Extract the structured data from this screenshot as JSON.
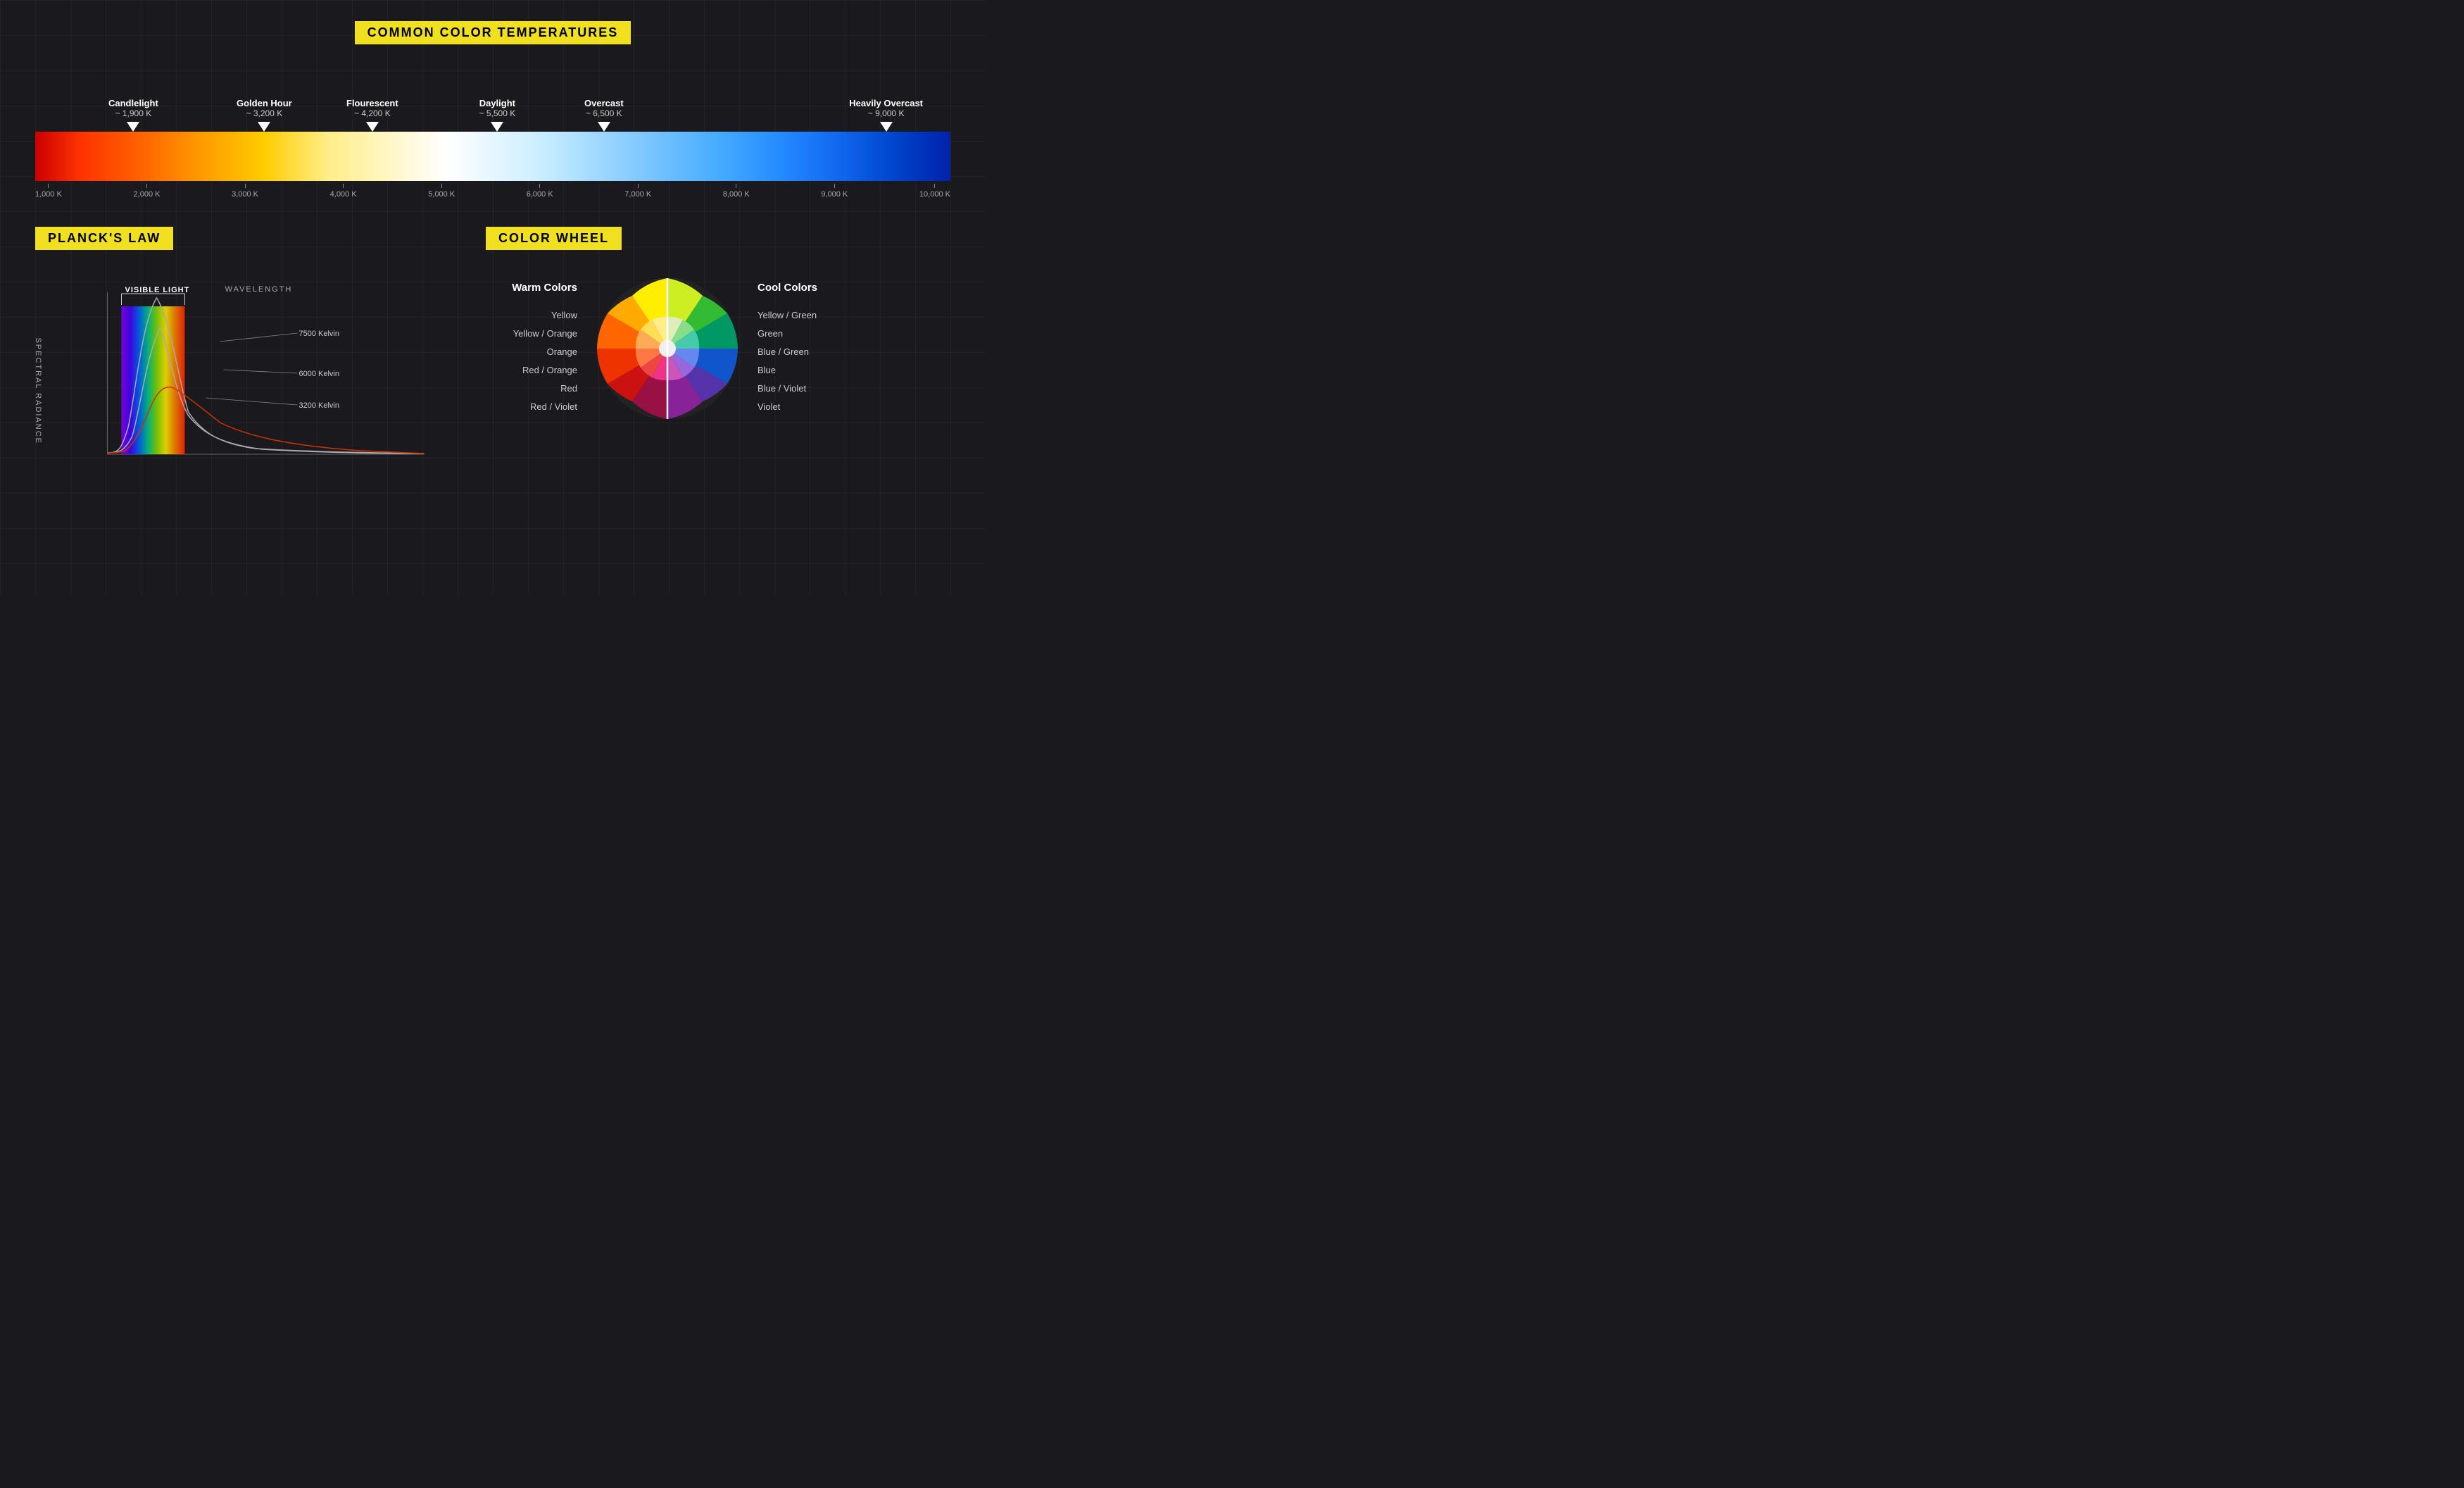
{
  "page": {
    "background": "#1a1a1e"
  },
  "temperature_section": {
    "title": "COMMON COLOR TEMPERATURES",
    "labels": [
      {
        "name": "Candlelight",
        "value": "~ 1,900 K",
        "position": 8
      },
      {
        "name": "Golden Hour",
        "value": "~ 3,200 K",
        "position": 23
      },
      {
        "name": "Flourescent",
        "value": "~ 4,200 K",
        "position": 34
      },
      {
        "name": "Daylight",
        "value": "~ 5,500 K",
        "position": 49
      },
      {
        "name": "Overcast",
        "value": "~ 6,500 K",
        "position": 60
      },
      {
        "name": "Heavily Overcast",
        "value": "~ 9,000 K",
        "position": 88
      }
    ],
    "ticks": [
      "1,000 K",
      "2,000 K",
      "3,000 K",
      "4,000 K",
      "5,000 K",
      "6,000 K",
      "7,000 K",
      "8,000 K",
      "9,000 K",
      "10,000 K"
    ]
  },
  "plancks_section": {
    "title": "PLANCK'S LAW",
    "y_axis": "SPECTRAL RADIANCE",
    "x_axis": "WAVELENGTH",
    "visible_light_label": "VISIBLE LIGHT",
    "curves": [
      {
        "label": "7500 Kelvin",
        "color": "#aaaaaa"
      },
      {
        "label": "6000 Kelvin",
        "color": "#aaaaaa"
      },
      {
        "label": "3200 Kelvin",
        "color": "#aaaaaa"
      }
    ]
  },
  "colorwheel_section": {
    "title": "COLOR WHEEL",
    "warm_header": "Warm Colors",
    "cool_header": "Cool Colors",
    "warm_labels": [
      "Yellow",
      "Yellow / Orange",
      "Orange",
      "Red / Orange",
      "Red",
      "Red / Violet"
    ],
    "cool_labels": [
      "Yellow / Green",
      "Green",
      "Blue / Green",
      "Blue",
      "Blue / Violet",
      "Violet"
    ]
  }
}
